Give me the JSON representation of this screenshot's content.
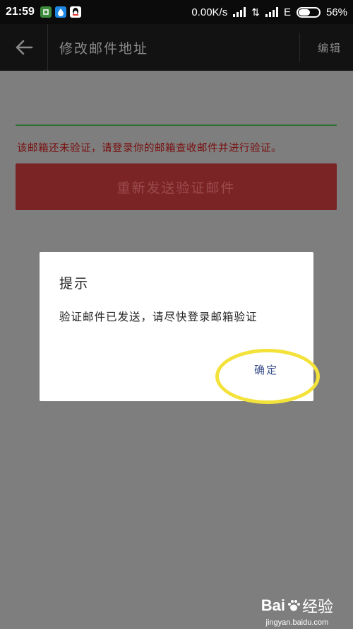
{
  "status_bar": {
    "time": "21:59",
    "network_speed": "0.00K/s",
    "network_type": "E",
    "battery": "56%",
    "battery_level": 0.56
  },
  "app_bar": {
    "title": "修改邮件地址",
    "edit_label": "编辑"
  },
  "content": {
    "warning": "该邮箱还未验证，请登录你的邮箱查收邮件并进行验证。",
    "resend_button": "重新发送验证邮件"
  },
  "dialog": {
    "title": "提示",
    "message": "验证邮件已发送，请尽快登录邮箱验证",
    "confirm": "确定"
  },
  "colors": {
    "accent_red": "#7b2426",
    "warning_red": "#7a0f0f",
    "highlight": "#f3e23a",
    "link_blue": "#3a4f8a"
  },
  "watermark": {
    "logo_left": "Bai",
    "logo_right": "经验",
    "url": "jingyan.baidu.com"
  }
}
